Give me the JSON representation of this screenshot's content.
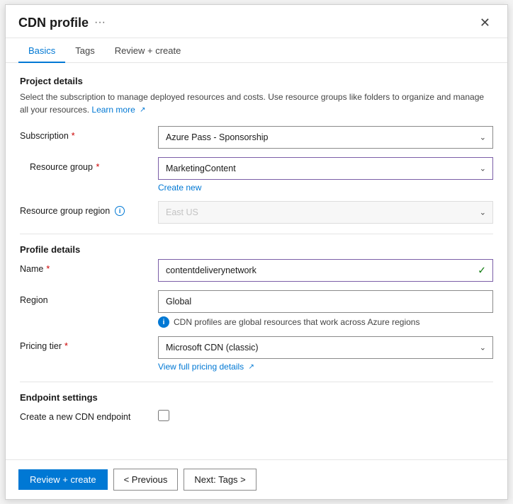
{
  "dialog": {
    "title": "CDN profile",
    "close_label": "✕",
    "ellipsis": "···"
  },
  "tabs": [
    {
      "id": "basics",
      "label": "Basics",
      "active": true
    },
    {
      "id": "tags",
      "label": "Tags",
      "active": false
    },
    {
      "id": "review",
      "label": "Review + create",
      "active": false
    }
  ],
  "project_details": {
    "section_title": "Project details",
    "description": "Select the subscription to manage deployed resources and costs. Use resource groups like folders to organize and manage all your resources.",
    "learn_more_label": "Learn more",
    "subscription_label": "Subscription",
    "subscription_required": "*",
    "subscription_value": "Azure Pass - Sponsorship",
    "resource_group_label": "Resource group",
    "resource_group_required": "*",
    "resource_group_value": "MarketingContent",
    "create_new_label": "Create new",
    "resource_group_region_label": "Resource group region",
    "resource_group_region_value": "East US"
  },
  "profile_details": {
    "section_title": "Profile details",
    "name_label": "Name",
    "name_required": "*",
    "name_value": "contentdeliverynetwork",
    "region_label": "Region",
    "region_value": "Global",
    "cdn_info_text": "CDN profiles are global resources that work across Azure regions",
    "pricing_tier_label": "Pricing tier",
    "pricing_tier_required": "*",
    "pricing_tier_value": "Microsoft CDN (classic)",
    "view_pricing_label": "View full pricing details"
  },
  "endpoint_settings": {
    "section_title": "Endpoint settings",
    "create_endpoint_label": "Create a new CDN endpoint"
  },
  "footer": {
    "review_create_label": "Review + create",
    "previous_label": "< Previous",
    "next_label": "Next: Tags >"
  }
}
